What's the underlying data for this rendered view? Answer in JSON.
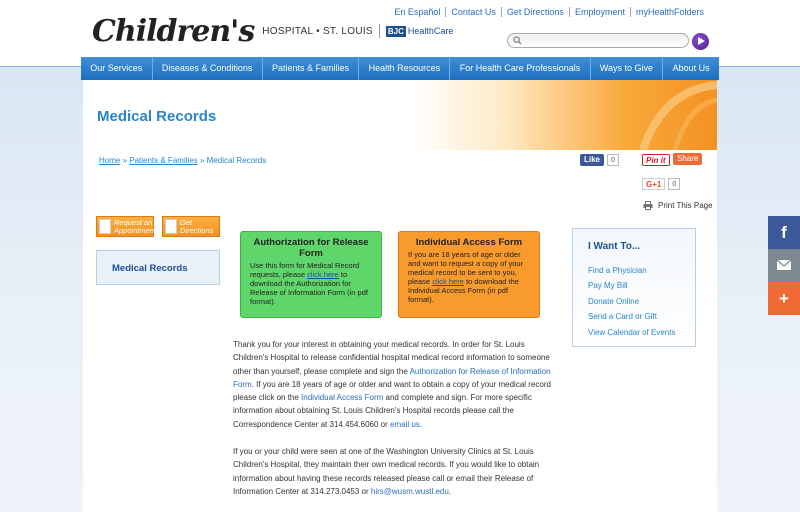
{
  "header": {
    "top_links": [
      "En Español",
      "Contact Us",
      "Get Directions",
      "Employment",
      "myHealthFolders"
    ],
    "logo": {
      "script": "Children's",
      "hospital": "HOSPITAL • ST. LOUIS",
      "bjc": "BJC",
      "healthcare": "HealthCare"
    },
    "search": {
      "placeholder": "",
      "value": ""
    }
  },
  "nav": {
    "items": [
      "Our Services",
      "Diseases & Conditions",
      "Patients & Families",
      "Health Resources",
      "For Health Care Professionals",
      "Ways to Give",
      "About Us"
    ]
  },
  "page": {
    "title": "Medical Records",
    "breadcrumb": {
      "home": "Home",
      "sep": " » ",
      "parent": "Patients & Families",
      "current": "Medical Records"
    }
  },
  "share": {
    "facebook_label": "Like",
    "facebook_count": "0",
    "pinterest_label": "Pin it",
    "pinterest_count": "0",
    "share_label": "Share",
    "gplus_label": "G+1",
    "gplus_count": "0",
    "print_label": "Print This Page"
  },
  "quick_buttons": {
    "request": "Request an Appointment",
    "directions": "Get Directions"
  },
  "side_nav": {
    "item": "Medical Records"
  },
  "forms": {
    "auth": {
      "title": "Authorization for Release Form",
      "text_before": "Use this form for Medical Record requests, please ",
      "link": "click here",
      "text_after": " to download the Authorization for Release of Information Form (in pdf format)."
    },
    "access": {
      "title": "Individual Access Form",
      "text_before": "If you are 18 years of age or older and want to request a copy of your medical record to be sent to you, please ",
      "link": "click here",
      "text_after": " to download the Individual Access Form (in pdf format)."
    }
  },
  "want_to": {
    "title": "I Want To...",
    "items": [
      "Find a Physician",
      "Pay My Bill",
      "Donate Online",
      "Send a Card or Gift",
      "View Calendar of Events"
    ]
  },
  "body": {
    "intro_1": "Thank you for your interest in obtaining your medical records.  In order for St. Louis Children's Hospital to release confidential hospital medical record information to someone other than yourself, please complete and sign the ",
    "intro_link1": "Authorization for Release of Information Form",
    "intro_2": ".  If you are 18 years of age or older and want to obtain a copy of your medical record please click on the ",
    "intro_link2": "Individual Access Form",
    "intro_3": " and complete and sign.  For more specific information about obtaining St. Louis Children's Hospital records please call the Correspondence Center at 314.454.6060 or ",
    "intro_link3": "email us",
    "intro_4": ".",
    "clinic_1": "If you or your child were seen at one of the Washington University Clinics at St. Louis Children's Hospital, they maintain their own medical records.  If you would like to obtain information about having these records released please call or email their Release of Information Center at 314.273.0453 or ",
    "clinic_link": "hirs@wusm.wustl.edu",
    "clinic_2": "."
  },
  "social": {
    "facebook": "f",
    "plus": "+"
  },
  "colors": {
    "nav": "#2a7ccb",
    "title": "#2a86c9",
    "green_box": "#5fd66a",
    "orange_box": "#f89a2c",
    "accent": "#f39223"
  }
}
